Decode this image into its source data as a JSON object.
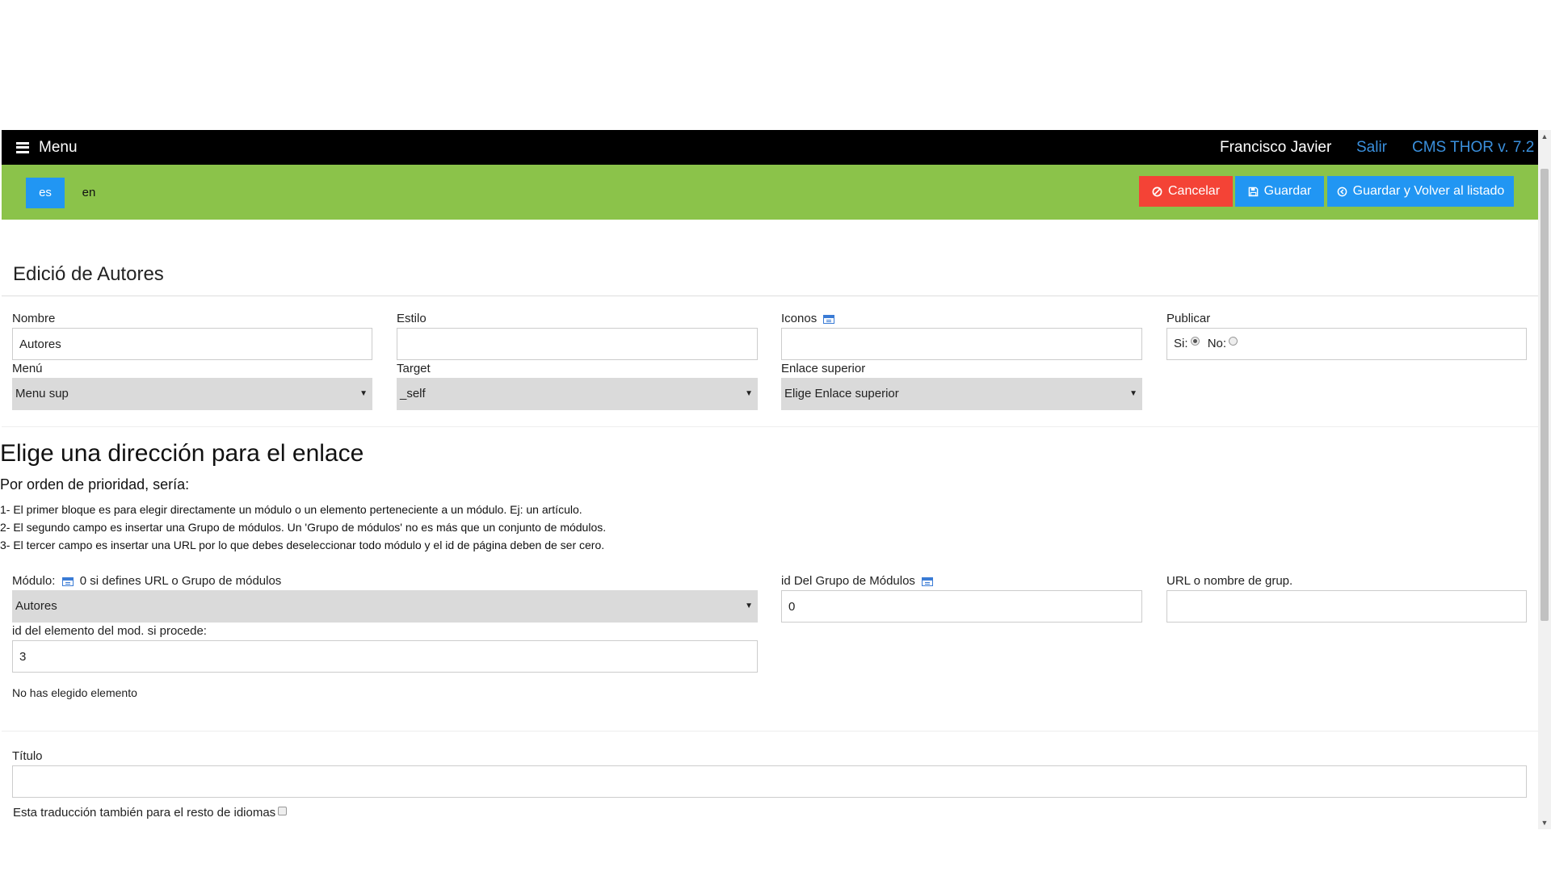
{
  "topbar": {
    "menu_label": "Menu",
    "user_name": "Francisco Javier",
    "logout_label": "Salir",
    "version_label": "CMS THOR v. 7.2"
  },
  "languages": [
    "es",
    "en"
  ],
  "actions": {
    "cancel_label": "Cancelar",
    "save_label": "Guardar",
    "save_back_label": "Guardar y Volver al listado"
  },
  "colors": {
    "topbar": "#000000",
    "langbar": "#8bc34a",
    "primary": "#2196f3",
    "danger": "#f44336",
    "link": "#3a8fdc"
  },
  "form": {
    "title": "Edició de Autores",
    "nombre": {
      "label": "Nombre",
      "value": "Autores"
    },
    "estilo": {
      "label": "Estilo",
      "value": ""
    },
    "iconos": {
      "label": "Iconos",
      "value": ""
    },
    "publicar": {
      "label": "Publicar",
      "si_label": "Si:",
      "no_label": "No:",
      "selected": "Si"
    },
    "menu": {
      "label": "Menú",
      "value": "Menu sup"
    },
    "target": {
      "label": "Target",
      "value": "_self"
    },
    "enlace_superior": {
      "label": "Enlace superior",
      "value": "Elige Enlace superior"
    }
  },
  "link_section": {
    "heading": "Elige una dirección para el enlace",
    "subheading": "Por orden de prioridad, sería:",
    "help_lines": [
      "1- El primer bloque es para elegir directamente un módulo o un elemento perteneciente a un módulo. Ej: un artículo.",
      "2- El segundo campo es insertar una Grupo de módulos. Un 'Grupo de módulos' no es más que un conjunto de módulos.",
      "3- El tercer campo es insertar una URL por lo que debes deseleccionar todo módulo y el id de página deben de ser cero."
    ],
    "modulo": {
      "label": "Módulo:",
      "hint": "0 si defines URL o Grupo de módulos",
      "value": "Autores"
    },
    "grupo_modulos": {
      "label": "id Del Grupo de Módulos",
      "value": "0"
    },
    "url": {
      "label": "URL o nombre de grup.",
      "value": ""
    },
    "elemento": {
      "label": "id del elemento del mod. si procede:",
      "value": "3"
    },
    "elemento_status": "No has elegido elemento"
  },
  "titulo": {
    "label": "Título",
    "value": "",
    "all_languages_label": "Esta traducción también para el resto de idiomas"
  }
}
